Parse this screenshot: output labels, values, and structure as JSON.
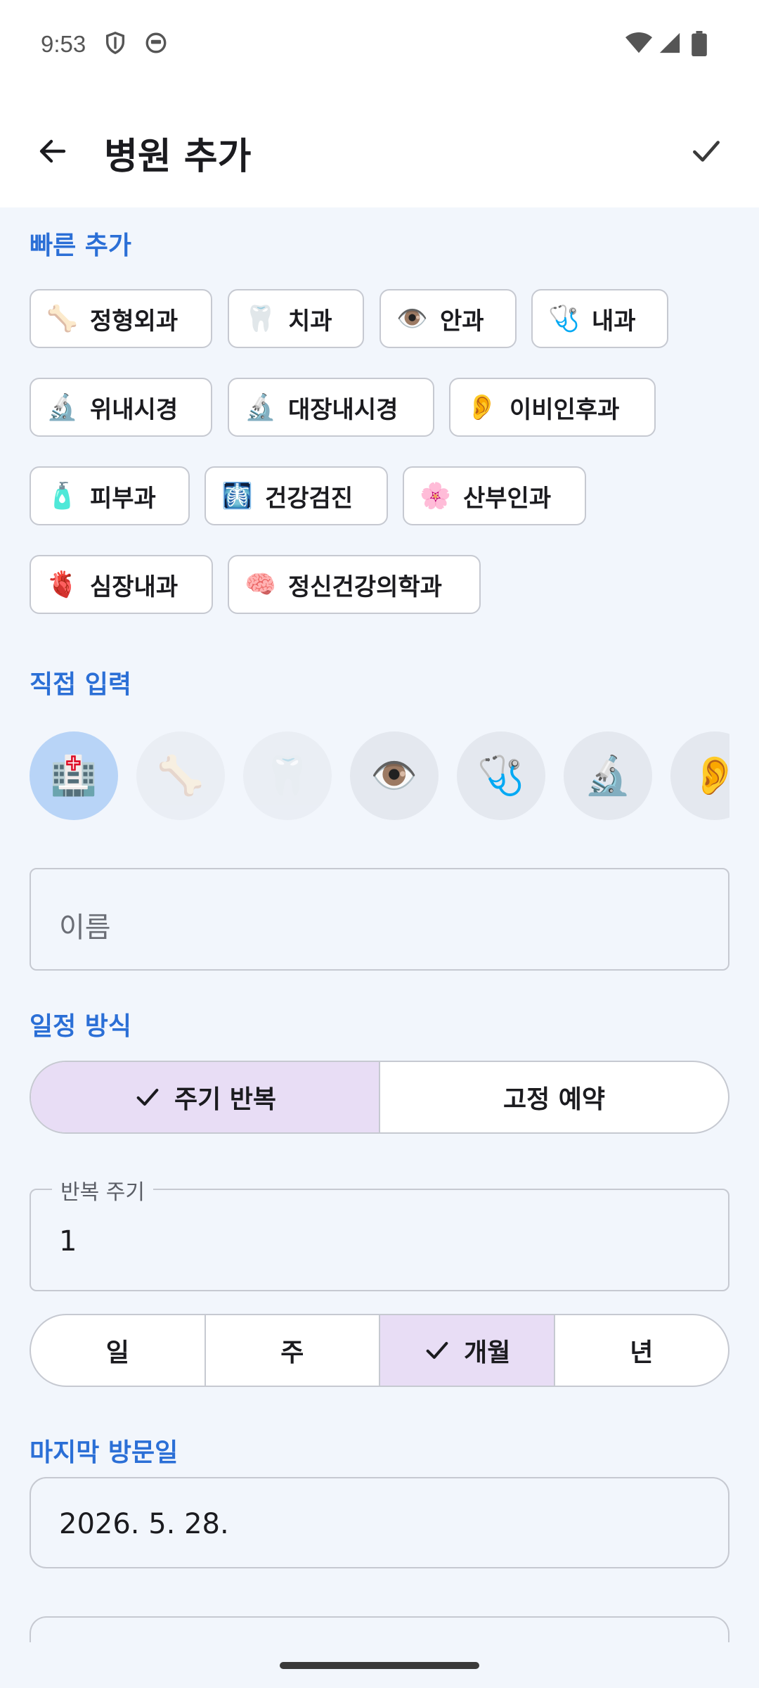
{
  "status": {
    "time": "9:53"
  },
  "app_bar": {
    "title": "병원 추가"
  },
  "quick_add": {
    "label": "빠른 추가",
    "chips": [
      {
        "emoji": "🦴",
        "label": "정형외과"
      },
      {
        "emoji": "🦷",
        "label": "치과"
      },
      {
        "emoji": "👁️",
        "label": "안과"
      },
      {
        "emoji": "🩺",
        "label": "내과"
      },
      {
        "emoji": "🔬",
        "label": "위내시경"
      },
      {
        "emoji": "🔬",
        "label": "대장내시경"
      },
      {
        "emoji": "👂",
        "label": "이비인후과"
      },
      {
        "emoji": "🧴",
        "label": "피부과"
      },
      {
        "emoji": "🩻",
        "label": "건강검진"
      },
      {
        "emoji": "🌸",
        "label": "산부인과"
      },
      {
        "emoji": "🫀",
        "label": "심장내과"
      },
      {
        "emoji": "🧠",
        "label": "정신건강의학과"
      }
    ]
  },
  "direct_input": {
    "label": "직접 입력",
    "icons": [
      "🏥",
      "🦴",
      "🦷",
      "👁️",
      "🩺",
      "🔬",
      "👂"
    ],
    "selected_index": 0,
    "name_placeholder": "이름"
  },
  "schedule": {
    "label": "일정 방식",
    "options": [
      "주기 반복",
      "고정 예약"
    ],
    "selected": "주기 반복",
    "interval_label": "반복 주기",
    "interval_value": "1",
    "units": [
      "일",
      "주",
      "개월",
      "년"
    ],
    "selected_unit": "개월"
  },
  "last_visit": {
    "label": "마지막 방문일",
    "value": "2026. 5. 28."
  },
  "colors": {
    "accent": "#2b6fd6",
    "selected_segment": "#e8ddf5",
    "selected_icon": "#b8d4f7",
    "background": "#f2f6fc"
  }
}
